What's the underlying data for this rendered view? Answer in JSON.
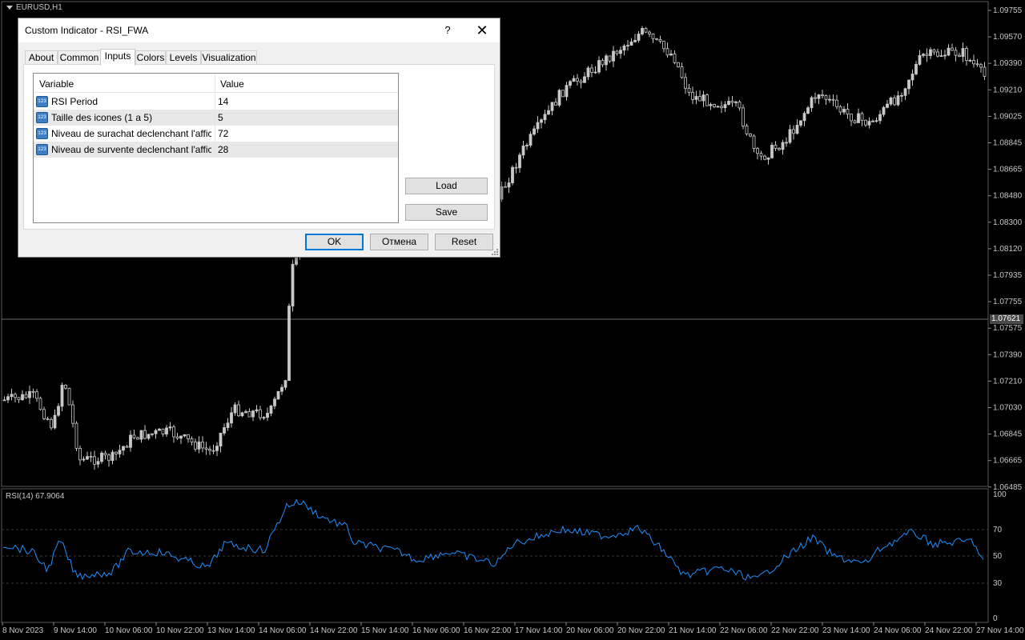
{
  "chart": {
    "symbol": "EURUSD,H1",
    "current_price": "1.07621",
    "price_ticks": [
      "1.09755",
      "1.09570",
      "1.09390",
      "1.09210",
      "1.09025",
      "1.08845",
      "1.08665",
      "1.08480",
      "1.08300",
      "1.08120",
      "1.07935",
      "1.07755",
      "1.07575",
      "1.07390",
      "1.07210",
      "1.07030",
      "1.06845",
      "1.06665",
      "1.06485"
    ],
    "time_ticks": [
      "8 Nov 2023",
      "9 Nov 14:00",
      "10 Nov 06:00",
      "10 Nov 22:00",
      "13 Nov 14:00",
      "14 Nov 06:00",
      "14 Nov 22:00",
      "15 Nov 14:00",
      "16 Nov 06:00",
      "16 Nov 22:00",
      "17 Nov 14:00",
      "20 Nov 06:00",
      "20 Nov 22:00",
      "21 Nov 14:00",
      "22 Nov 06:00",
      "22 Nov 22:00",
      "23 Nov 14:00",
      "24 Nov 06:00",
      "24 Nov 22:00",
      "27 Nov 14:00"
    ],
    "rsi_label": "RSI(14) 67.9064",
    "rsi_levels": [
      "100",
      "70",
      "50",
      "30",
      "0"
    ],
    "colors": {
      "background": "#000000",
      "candles": "#c8c8c8",
      "rsi_line": "#1e90ff",
      "grid": "#3a3a3a"
    }
  },
  "dialog": {
    "title": "Custom Indicator - RSI_FWA",
    "help_label": "?",
    "close_label": "✕",
    "tabs": [
      "About",
      "Common",
      "Inputs",
      "Colors",
      "Levels",
      "Visualization"
    ],
    "active_tab": "Inputs",
    "grid": {
      "col_variable": "Variable",
      "col_value": "Value",
      "rows": [
        {
          "icon": "123",
          "variable": "RSI Period",
          "value": "14"
        },
        {
          "icon": "123",
          "variable": "Taille des icones (1 a 5)",
          "value": "5"
        },
        {
          "icon": "123",
          "variable": "Niveau de surachat declenchant l'affich...",
          "value": "72"
        },
        {
          "icon": "123",
          "variable": "Niveau de survente declenchant l'affich...",
          "value": "28"
        }
      ]
    },
    "buttons": {
      "load": "Load",
      "save": "Save",
      "ok": "OK",
      "cancel": "Отмена",
      "reset": "Reset"
    }
  }
}
